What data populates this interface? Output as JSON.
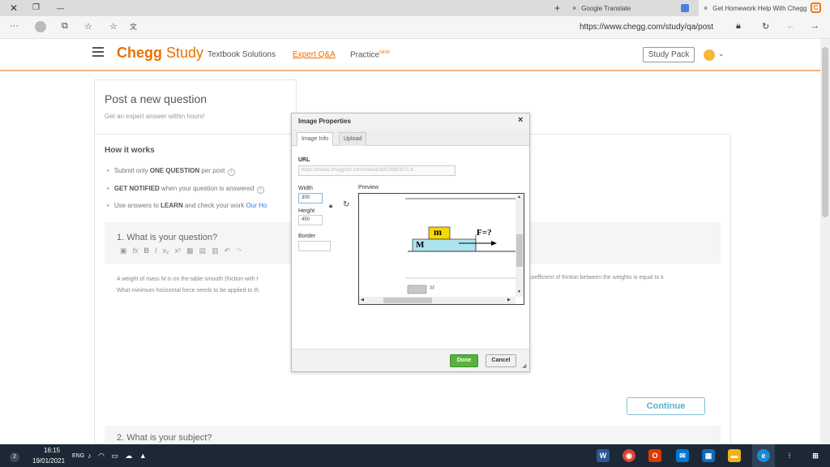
{
  "browser": {
    "tabs": [
      {
        "label": "Google Translate",
        "close": "×"
      },
      {
        "label": "Get Homework Help With Chegg",
        "close": "×"
      }
    ],
    "new_tab": "+",
    "url": "https://www.chegg.com/study/qa/post",
    "tab_ctrl_close": "✕",
    "tab_ctrl_restore": "❐",
    "tab_ctrl_min": "—"
  },
  "header": {
    "logo_chegg": "Chegg",
    "logo_study": "Study",
    "nav": [
      "Textbook Solutions",
      "Expert Q&A",
      "Practice"
    ],
    "nav_badge": "NEW!",
    "study_pack": "Study Pack"
  },
  "sidebar": {
    "title": "Post a new question",
    "subtitle": "Get an expert answer within hours!",
    "how_title": "How it works",
    "items": [
      {
        "pre": "Submit only ",
        "bold": "ONE QUESTION",
        "post": " per post"
      },
      {
        "pre": "",
        "bold": "GET NOTIFIED",
        "post": " when your question is answered"
      },
      {
        "pre": "Use answers to ",
        "bold": "LEARN",
        "post": " and check your work ",
        "link": "Our Ho"
      }
    ]
  },
  "question": {
    "title": "1. What is your question?",
    "text_line1": "A weight of mass M is on the table smooth (friction with t",
    "text_line2": "What minimum horizontal force needs to be applied to th",
    "text_right": "coefficient of friction between the weights is equal to k",
    "continue_label": "Continue",
    "subject_title": "2. What is your subject?"
  },
  "dialog": {
    "title": "Image Properties",
    "close": "×",
    "tabs": [
      "Image Info",
      "Upload"
    ],
    "url_label": "URL",
    "url_value": "https://media.cheggcdn.com/media/166/1666327c-b",
    "width_label": "Width",
    "width_value": "300",
    "height_label": "Height",
    "height_value": "450",
    "border_label": "Border",
    "border_value": "",
    "preview_label": "Preview",
    "preview_small_m": "m",
    "preview_big_m": "M",
    "preview_force": "F=?",
    "preview_lower_m": "M",
    "done_label": "Done",
    "cancel_label": "Cancel"
  },
  "taskbar": {
    "badge": "2",
    "time": "16:15",
    "date": "19/01/2021",
    "lang": "ENG"
  }
}
